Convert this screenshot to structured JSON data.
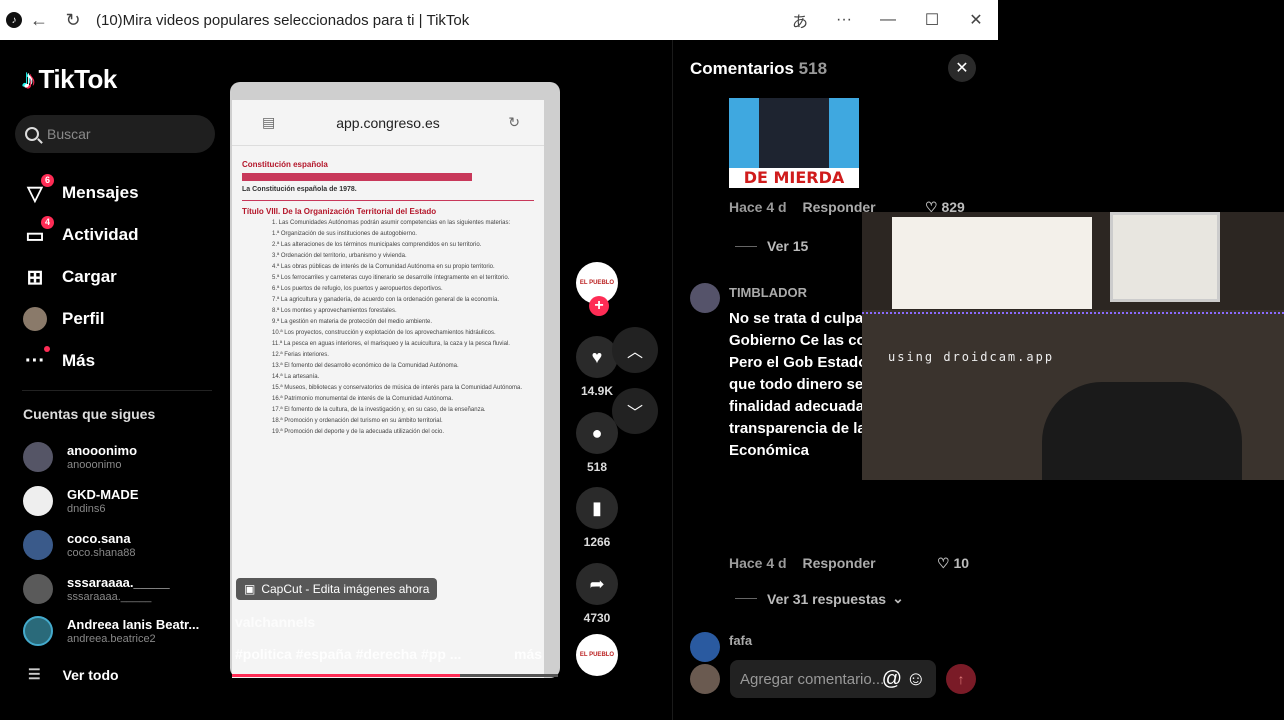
{
  "browser": {
    "title": "(10)Mira videos populares seleccionados para ti | TikTok",
    "translate_icon": "translate-icon",
    "more_icon": "ellipsis-icon"
  },
  "brand": {
    "name": "TikTok"
  },
  "search": {
    "placeholder": "Buscar"
  },
  "nav": [
    {
      "label": "Mensajes",
      "icon": "messages-icon",
      "badge": "6"
    },
    {
      "label": "Actividad",
      "icon": "activity-icon",
      "badge": "4"
    },
    {
      "label": "Cargar",
      "icon": "upload-icon",
      "badge": ""
    },
    {
      "label": "Perfil",
      "icon": "profile-icon",
      "badge": ""
    },
    {
      "label": "Más",
      "icon": "more-icon",
      "badge": ""
    }
  ],
  "following": {
    "title": "Cuentas que sigues",
    "accounts": [
      {
        "name": "anooonimo",
        "handle": "anooonimo"
      },
      {
        "name": "GKD-MADE",
        "handle": "dndins6"
      },
      {
        "name": "coco.sana",
        "handle": "coco.shana88"
      },
      {
        "name": "sssaraaaa._____",
        "handle": "sssaraaaa._____"
      },
      {
        "name": "Andreea Ianis Beatr...",
        "handle": "andreea.beatrice2"
      }
    ],
    "see_all": "Ver todo"
  },
  "video": {
    "url": "app.congreso.es",
    "doc_header": "Constitución española",
    "doc_subtitle": "La Constitución española de 1978.",
    "doc_title": "Título VIII. De la Organización Territorial del Estado",
    "doc_items": [
      "1. Las Comunidades Autónomas podrán asumir competencias en las siguientes materias:",
      "1.ª Organización de sus instituciones de autogobierno.",
      "2.ª Las alteraciones de los términos municipales comprendidos en su territorio.",
      "3.ª Ordenación del territorio, urbanismo y vivienda.",
      "4.ª Las obras públicas de interés de la Comunidad Autónoma en su propio territorio.",
      "5.ª Los ferrocarriles y carreteras cuyo itinerario se desarrolle íntegramente en el territorio.",
      "6.ª Los puertos de refugio, los puertos y aeropuertos deportivos.",
      "7.ª La agricultura y ganadería, de acuerdo con la ordenación general de la economía.",
      "8.ª Los montes y aprovechamientos forestales.",
      "9.ª La gestión en materia de protección del medio ambiente.",
      "10.ª Los proyectos, construcción y explotación de los aprovechamientos hidráulicos.",
      "11.ª La pesca en aguas interiores, el marisqueo y la acuicultura, la caza y la pesca fluvial.",
      "12.ª Ferias interiores.",
      "13.ª El fomento del desarrollo económico de la Comunidad Autónoma.",
      "14.ª La artesanía.",
      "15.ª Museos, bibliotecas y conservatorios de música de interés para la Comunidad Autónoma.",
      "16.ª Patrimonio monumental de interés de la Comunidad Autónoma.",
      "17.ª El fomento de la cultura, de la investigación y, en su caso, de la enseñanza.",
      "18.ª Promoción y ordenación del turismo en su ámbito territorial.",
      "19.ª Promoción del deporte y de la adecuada utilización del ocio."
    ],
    "capcut": "CapCut - Edita imágenes ahora",
    "author": "valchannels",
    "tags": "#politica #españa #derecha #pp ...",
    "more": "más",
    "progress": 0.7
  },
  "actions": {
    "likes": "14.9K",
    "comments": "518",
    "saves": "1266",
    "shares": "4730"
  },
  "comments": {
    "title": "Comentarios",
    "count": "518",
    "image_caption": "DE MIERDA",
    "c1": {
      "time": "Hace 4 d",
      "reply": "Responder",
      "likes": "829",
      "replies": "Ver 15"
    },
    "c2": {
      "user": "TIMBLADOR",
      "text": "No se trata d culpa de lo d Gobierno Ce las compete Pero el Gob Estado es, c de que todo dinero se uti finalidad adecuada y halla transparencia de la Gestión Económica",
      "time": "Hace 4 d",
      "reply": "Responder",
      "likes": "10",
      "replies": "Ver 31 respuestas"
    },
    "c3": {
      "user": "fafa"
    },
    "input_placeholder": "Agregar comentario..."
  },
  "webcam": {
    "watermark": "using droidcam.app"
  }
}
